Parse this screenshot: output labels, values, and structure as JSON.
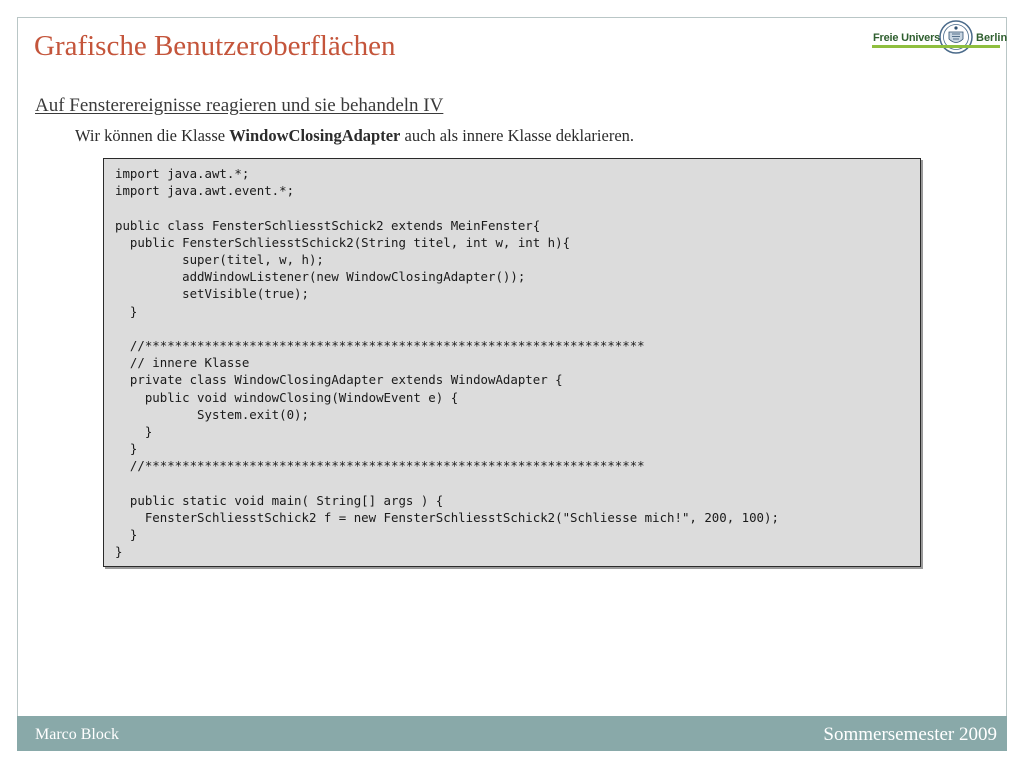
{
  "slide": {
    "title": "Grafische Benutzeroberflächen",
    "subheading": "Auf Fensterereignisse reagieren und sie behandeln IV",
    "intro": {
      "before": "Wir können die Klasse ",
      "emphasis": "WindowClosingAdapter",
      "after": " auch als innere Klasse deklarieren."
    }
  },
  "logo": {
    "left_text": "Freie Universität",
    "right_text": "Berlin",
    "seal_icon": "university-seal-icon",
    "accent_color": "#8fbf3f"
  },
  "code": {
    "lines": [
      "import java.awt.*;",
      "import java.awt.event.*;",
      "",
      "public class FensterSchliesstSchick2 extends MeinFenster{",
      "  public FensterSchliesstSchick2(String titel, int w, int h){",
      "         super(titel, w, h);",
      "         addWindowListener(new WindowClosingAdapter());",
      "         setVisible(true);",
      "  }",
      "",
      "  //*******************************************************************",
      "  // innere Klasse",
      "  private class WindowClosingAdapter extends WindowAdapter {",
      "    public void windowClosing(WindowEvent e) {",
      "           System.exit(0);",
      "    }",
      "  }",
      "  //*******************************************************************",
      "",
      "  public static void main( String[] args ) {",
      "    FensterSchliesstSchick2 f = new FensterSchliesstSchick2(\"Schliesse mich!\", 200, 100);",
      "  }",
      "}"
    ]
  },
  "footer": {
    "author": "Marco Block",
    "semester": "Sommersemester 2009"
  },
  "colors": {
    "title": "#c4553b",
    "footer_bg": "#89a9a9",
    "code_bg": "#dcdcdc"
  }
}
